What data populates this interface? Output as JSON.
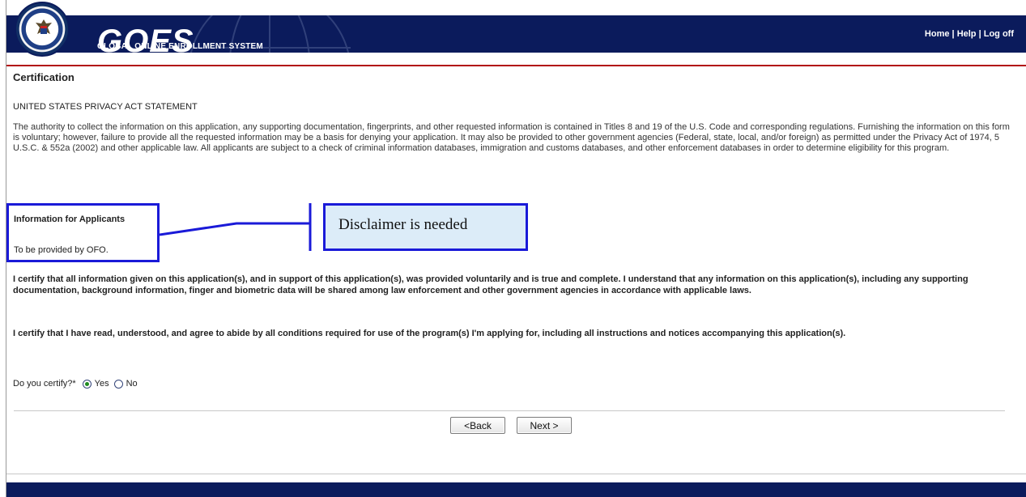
{
  "header": {
    "logo_text": "GOES",
    "logo_subtitle": "GLOBAL ONLINE ENROLLMENT SYSTEM",
    "seal_text": "U.S. DEPARTMENT OF HOMELAND SECURITY",
    "links": [
      "Home",
      "Help",
      "Log off"
    ],
    "separator": "|",
    "bar_color": "#0b1b5c",
    "accent_line_color": "#b20e10"
  },
  "page": {
    "title": "Certification",
    "privacy_heading": "UNITED STATES PRIVACY ACT STATEMENT",
    "privacy_body": "The authority to collect the information on this application, any supporting documentation, fingerprints, and other requested information is contained in Titles 8 and 19 of the U.S. Code and corresponding regulations. Furnishing the information on this form is voluntary; however, failure to provide all the requested information may be a basis for denying your application. It may also be provided to other government agencies (Federal, state, local, and/or foreign) as permitted under the Privacy Act of 1974, 5 U.S.C. & 552a (2002) and other applicable law. All applicants are subject to a check of criminal information databases, immigration and customs databases, and other enforcement databases in order to determine eligibility for this program.",
    "info_title": "Information for Applicants",
    "info_text": "To be provided by OFO.",
    "annotation": "Disclaimer is needed",
    "certify_statement_1": "I certify that all information given on this application(s), and in support of this application(s), was provided voluntarily and is true and complete. I understand that any information on this application(s), including any supporting documentation, background information, finger and biometric data will be shared among law enforcement and other government agencies in accordance with applicable laws.",
    "certify_statement_2": "I certify that I have read, understood, and agree to abide by all conditions required for use of the program(s) I'm applying for, including all instructions and notices accompanying this application(s).",
    "question": "Do you certify?*",
    "options": [
      "Yes",
      "No"
    ],
    "selected_option": "Yes",
    "buttons": {
      "back": "<Back",
      "next": "Next >"
    },
    "annotation_color": "#1a1ad8"
  }
}
